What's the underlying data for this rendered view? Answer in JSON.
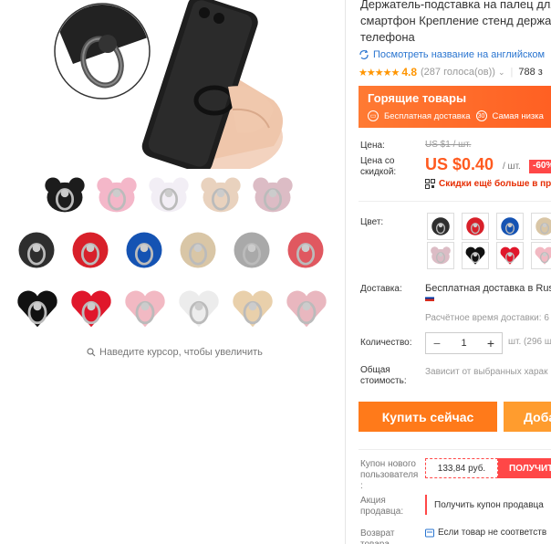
{
  "gallery": {
    "zoom_hint": "Наведите курсор, чтобы увеличить"
  },
  "product": {
    "title_lines": [
      "Держатель-подставка на палец для",
      "смартфон Крепление стенд держат",
      "телефона"
    ],
    "translate_link": "Посмотреть название на английском",
    "rating": {
      "stars": "★★★★★",
      "score": "4.8",
      "votes": "(287 голоса(ов))",
      "orders": "788 з"
    }
  },
  "hot_banner": {
    "title": "Горящие товары",
    "free_shipping": "Бесплатная доставка",
    "days_badge": "30",
    "cheapest": "Самая низка"
  },
  "price": {
    "label": "Цена:",
    "old": "US $1 / шт.",
    "discount_label": "Цена со скидкой:",
    "new": "US $0.40",
    "unit": "/ шт.",
    "discount": "-60%",
    "app_promo": "Скидки ещё больше в прил"
  },
  "options": {
    "color_label": "Цвет:",
    "shipping_label": "Доставка:",
    "shipping_main": "Бесплатная доставка в Russ",
    "shipping_time": "Расчётное время доставки: 6",
    "quantity_label": "Количество:",
    "quantity_value": "1",
    "quantity_note": "шт. (296 ш",
    "total_label": "Общая стоимость:",
    "total_text": "Зависит от выбранных харак"
  },
  "actions": {
    "buy_now": "Купить сейчас",
    "add_to_cart": "Доба"
  },
  "coupons": {
    "new_user_label": "Купон нового пользователя",
    "new_user_colon": ":",
    "coupon_value": "133,84 руб.",
    "coupon_get": "ПОЛУЧИТ",
    "promo_label": "Акция продавца:",
    "promo_text": "Получить купон продавца",
    "return_label": "Возврат товара",
    "return_text": "Если товар не соответств"
  },
  "colors": {
    "accent": "#ff5a1f",
    "link": "#2a75d0",
    "star": "#ff9500",
    "discount": "#ff4747"
  }
}
